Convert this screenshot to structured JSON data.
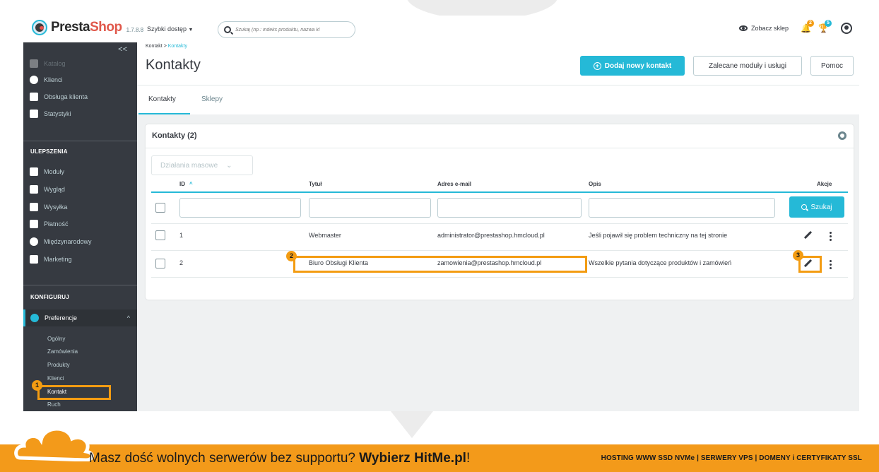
{
  "app": {
    "logo_presta": "Presta",
    "logo_shop": "Shop",
    "version": "1.7.8.8"
  },
  "topbar": {
    "quick_access": "Szybki dostęp",
    "search_placeholder": "Szukaj (np.: indeks produktu, nazwa kl",
    "view_shop": "Zobacz sklep",
    "notif_orders": "2",
    "notif_trophy": "5"
  },
  "sidebar": {
    "collapse": "<<",
    "items_top": [
      {
        "label": "Katalog",
        "icon": "catalog-icon"
      },
      {
        "label": "Klienci",
        "icon": "customers-icon"
      },
      {
        "label": "Obsługa klienta",
        "icon": "chat-icon"
      },
      {
        "label": "Statystyki",
        "icon": "stats-icon"
      }
    ],
    "section_improve": "ULEPSZENIA",
    "items_improve": [
      {
        "label": "Moduły",
        "icon": "puzzle-icon"
      },
      {
        "label": "Wygląd",
        "icon": "monitor-icon"
      },
      {
        "label": "Wysyłka",
        "icon": "truck-icon"
      },
      {
        "label": "Płatność",
        "icon": "card-icon"
      },
      {
        "label": "Międzynarodowy",
        "icon": "globe-icon"
      },
      {
        "label": "Marketing",
        "icon": "megaphone-icon"
      }
    ],
    "section_configure": "KONFIGURUJ",
    "preferences": "Preferencje",
    "sub_items": [
      "Ogólny",
      "Zamówienia",
      "Produkty",
      "Klienci",
      "Kontakt",
      "Ruch"
    ]
  },
  "header": {
    "breadcrumb_parent": "Kontakt",
    "breadcrumb_sep": ">",
    "breadcrumb_current": "Kontakty",
    "title": "Kontakty",
    "add_button": "Dodaj nowy kontakt",
    "recommended_button": "Zalecane moduły i usługi",
    "help_button": "Pomoc"
  },
  "tabs": [
    "Kontakty",
    "Sklepy"
  ],
  "panel": {
    "title": "Kontakty (2)",
    "bulk_actions": "Działania masowe",
    "columns": {
      "id": "ID",
      "title": "Tytuł",
      "email": "Adres e-mail",
      "desc": "Opis",
      "actions": "Akcje"
    },
    "search_button": "Szukaj",
    "rows": [
      {
        "id": "1",
        "title": "Webmaster",
        "email": "administrator@prestashop.hmcloud.pl",
        "desc": "Jeśli pojawił się problem techniczny na tej stronie"
      },
      {
        "id": "2",
        "title": "Biuro Obsługi Klienta",
        "email": "zamowienia@prestashop.hmcloud.pl",
        "desc": "Wszelkie pytania dotyczące produktów i zamówień"
      }
    ]
  },
  "annotations": [
    "1",
    "2",
    "3"
  ],
  "banner": {
    "text_plain": "Masz dość wolnych serwerów bez supportu? ",
    "text_bold": "Wybierz HitMe.pl",
    "text_end": "!",
    "right": "HOSTING WWW SSD NVMe | SERWERY VPS | DOMENY i CERTYFIKATY SSL"
  },
  "colors": {
    "accent": "#25b9d7",
    "sidebar": "#363a41",
    "highlight": "#f39c12",
    "banner": "#f39a1a"
  }
}
